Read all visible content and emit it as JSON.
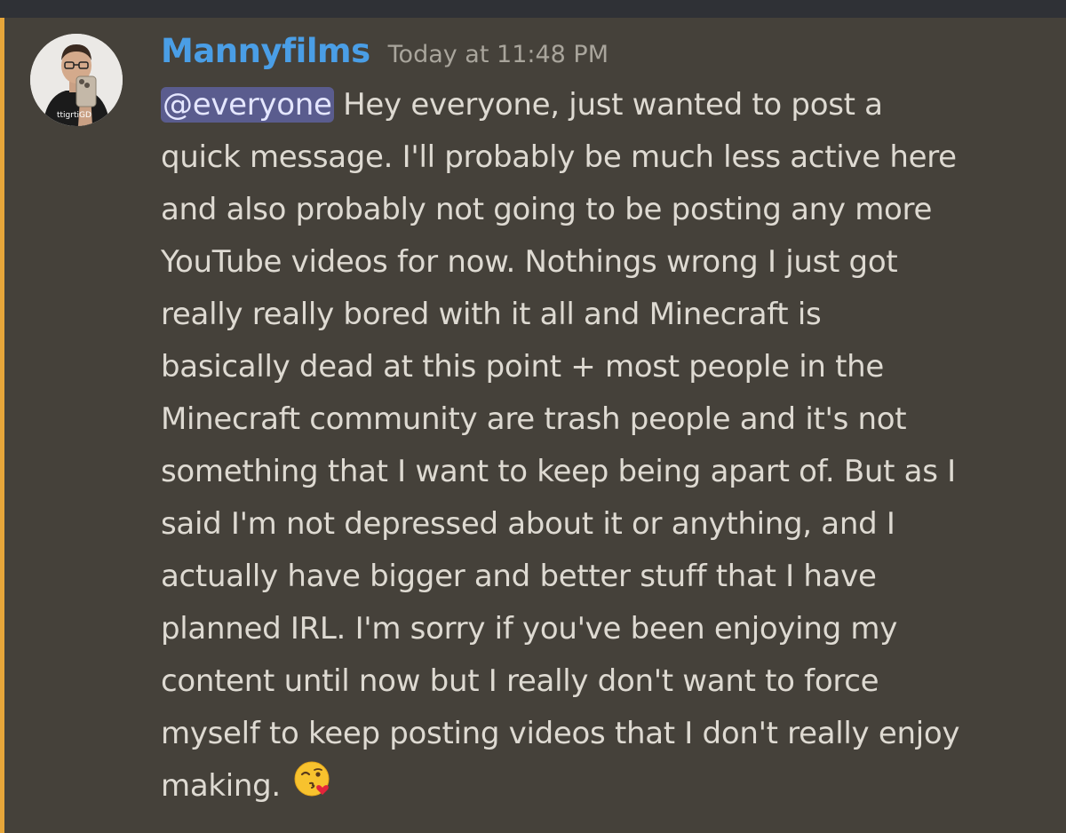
{
  "message": {
    "author": "Mannyfilms",
    "timestamp": "Today at 11:48 PM",
    "mention": "@everyone",
    "lines": [
      " Hey everyone, just wanted to post a",
      "quick message. I'll probably be much less active here",
      "and also probably not going to be posting any more",
      "YouTube videos for now. Nothings wrong I just got",
      "really really bored with it all and Minecraft is",
      "basically dead at this point + most people in the",
      "Minecraft community are trash people and it's not",
      "something that I want to keep being apart of. But as I",
      "said I'm not depressed about it or anything, and I",
      "actually have bigger and better stuff that I have",
      "planned IRL. I'm sorry if you've been enjoying my",
      "content until now but I really don't want to force",
      "myself to keep posting videos that I don't really enjoy",
      "making."
    ],
    "emoji": "face-throwing-a-kiss-icon",
    "avatar_text": "ttigrtiGD"
  },
  "colors": {
    "background": "#45413a",
    "mention_highlight_bar": "#e6a63a",
    "username": "#4a9ee6",
    "mention_pill": "#5a5c8e"
  }
}
